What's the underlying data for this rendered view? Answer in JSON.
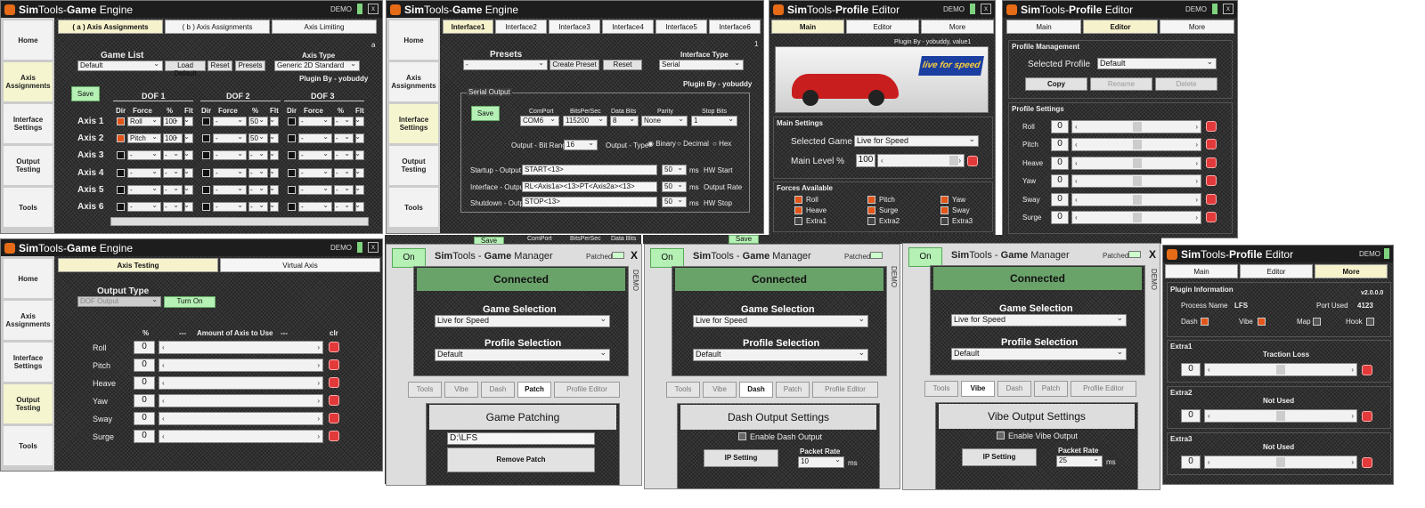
{
  "common": {
    "sim": "Sim",
    "tools": "Tools",
    "dash": " - ",
    "demo": "DEMO",
    "close": "x",
    "plugin_by": "Plugin By - yobuddy",
    "save": "Save"
  },
  "sidebar": {
    "home": "Home",
    "axis": "Axis Assignments",
    "iface": "Interface Settings",
    "output": "Output Testing",
    "tools": "Tools"
  },
  "ge1": {
    "game": "Game",
    "engine": "Engine",
    "tabs": [
      "( a ) Axis Assignments",
      "( b ) Axis Assignments",
      "Axis Limiting"
    ],
    "corner": "a",
    "game_list": "Game List",
    "game_value": "Default",
    "load_default": "Load Default",
    "reset": "Reset",
    "presets": "Presets",
    "axis_type": "Axis Type",
    "axis_type_value": "Generic 2D Standard",
    "dof": [
      "DOF 1",
      "DOF 2",
      "DOF 3"
    ],
    "col_dir": "Dir",
    "col_force": "Force",
    "col_pct": "%",
    "col_flt": "Flt",
    "axes": [
      "Axis 1",
      "Axis 2",
      "Axis 3",
      "Axis 4",
      "Axis 5",
      "Axis 6"
    ],
    "r1_force": "Roll",
    "r1_pct": "100",
    "r2_force": "Pitch",
    "r2_pct": "100",
    "r1_pct2": "50",
    "r2_pct2": "50",
    "dash_val": "-"
  },
  "ge2": {
    "tabs": [
      "Interface1",
      "Interface2",
      "Interface3",
      "Interface4",
      "Interface5",
      "Interface6"
    ],
    "corner": "1",
    "presets": "Presets",
    "preset_value": "-",
    "create_preset": "Create Preset",
    "reset": "Reset",
    "iface_type": "Interface Type",
    "iface_value": "Serial",
    "serial_output": "Serial Output",
    "comport": "ComPort",
    "bits": "BitsPerSec",
    "databits": "Data Bits",
    "parity": "Parity",
    "stopbits": "Stop Bits",
    "comport_v": "COM6",
    "bits_v": "115200",
    "databits_v": "8",
    "parity_v": "None",
    "stopbits_v": "1",
    "bitrange": "Output - Bit Range",
    "bitrange_v": "16",
    "otype": "Output - Type",
    "binary": "Binary",
    "decimal": "Decimal",
    "hex": "Hex",
    "startup": "Startup - Output",
    "startup_v": "START<13>",
    "interface": "Interface - Output",
    "interface_v": "RL<Axis1a><13>PT<Axis2a><13>",
    "shutdown": "Shutdown - Output",
    "shutdown_v": "STOP<13>",
    "ms": "ms",
    "t50": "50",
    "hw_start": "HW Start",
    "out_rate": "Output Rate",
    "hw_stop": "HW Stop",
    "bottom_save": "Save",
    "bottom_comport": "ComPort",
    "bottom_bits": "BitsPerSec",
    "bottom_data": "Data Bits"
  },
  "pe1": {
    "profile": "Profile",
    "editor": "Editor",
    "tabs": [
      "Main",
      "Editor",
      "More"
    ],
    "plugin": "Plugin By - yobuddy, value1",
    "banner": "live for speed",
    "main_settings": "Main Settings",
    "selected_game": "Selected Game",
    "game_v": "Live for Speed",
    "main_level": "Main Level %",
    "main_level_v": "100",
    "forces": "Forces Available",
    "force_items": [
      "Roll",
      "Pitch",
      "Yaw",
      "Heave",
      "Surge",
      "Sway",
      "Extra1",
      "Extra2",
      "Extra3"
    ]
  },
  "pe2": {
    "mgmt": "Profile Management",
    "selected_profile": "Selected Profile",
    "profile_v": "Default",
    "copy": "Copy",
    "rename": "Rename",
    "delete": "Delete",
    "settings": "Profile Settings",
    "rows": [
      "Roll",
      "Pitch",
      "Heave",
      "Yaw",
      "Sway",
      "Surge"
    ],
    "zero": "0"
  },
  "ge3": {
    "tabs": [
      "Axis Testing",
      "Virtual Axis"
    ],
    "output_type": "Output Type",
    "dof_output": "DOF Output",
    "turn_on": "Turn On",
    "pct": "%",
    "dashes": "---",
    "amount": "Amount of Axis to Use",
    "clr": "clr",
    "rows": [
      "Roll",
      "Pitch",
      "Heave",
      "Yaw",
      "Sway",
      "Surge"
    ],
    "zero": "0"
  },
  "gm": {
    "on": "On",
    "game": "Game",
    "manager": "Manager",
    "patched": "Patched",
    "connected": "Connected",
    "game_selection": "Game Selection",
    "game_v": "Live for Speed",
    "profile_selection": "Profile Selection",
    "profile_v": "Default",
    "tabs": [
      "Tools",
      "Vibe",
      "Dash",
      "Patch",
      "Profile Editor"
    ],
    "x": "X",
    "demo": "DEMO",
    "mo": "MO"
  },
  "gm1": {
    "title": "Game Patching",
    "path": "D:\\LFS",
    "remove": "Remove Patch"
  },
  "gm2": {
    "title": "Dash Output Settings",
    "enable": "Enable Dash Output",
    "ip": "IP Setting",
    "rate": "Packet Rate",
    "rate_v": "10",
    "ms": "ms"
  },
  "gm3": {
    "title": "Vibe Output Settings",
    "enable": "Enable Vibe Output",
    "ip": "IP Setting",
    "rate": "Packet Rate",
    "rate_v": "25",
    "ms": "ms"
  },
  "pe3": {
    "info": "Plugin Information",
    "version": "v2.0.0.0",
    "process": "Process Name",
    "process_v": "LFS",
    "port": "Port Used",
    "port_v": "4123",
    "dash": "Dash",
    "vibe": "Vibe",
    "map": "Map",
    "hook": "Hook",
    "extra1": "Extra1",
    "extra2": "Extra2",
    "extra3": "Extra3",
    "traction": "Traction Loss",
    "not_used": "Not Used",
    "zero": "0"
  },
  "colors": {
    "accent_orange": "#e2561a",
    "green": "#b5f0b5",
    "connected": "#6aa36a",
    "red": "#e23a3a"
  }
}
